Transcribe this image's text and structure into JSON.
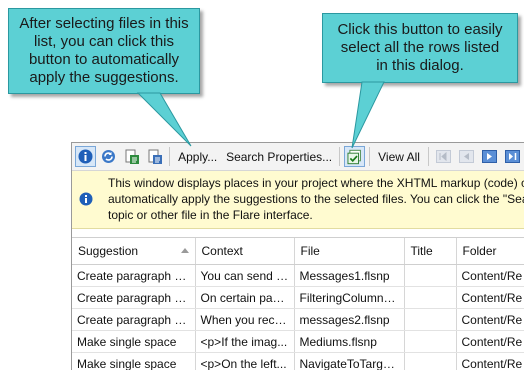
{
  "callouts": {
    "left": [
      "After selecting files in this",
      "list, you can click this",
      "button to automatically",
      "apply the suggestions."
    ],
    "right": [
      "Click this button to easily",
      "select all the rows listed",
      "in this dialog."
    ],
    "fill_color": "#5cd0d4"
  },
  "toolbar": {
    "apply_label": "Apply...",
    "search_properties_label": "Search Properties...",
    "view_all_label": "View All",
    "icons": [
      "info-icon",
      "refresh-icon",
      "open-file-icon",
      "open-file-alt-icon",
      "select-all-icon",
      "first-page-icon",
      "previous-page-icon",
      "next-page-icon",
      "last-page-icon"
    ]
  },
  "info_bar": {
    "lines": [
      "This window displays places in your project where the XHTML markup (code) c",
      "automatically apply the suggestions to the selected files. You can click the \"Sea",
      "topic or other file in the Flare interface."
    ],
    "background": "#fffbd0"
  },
  "table": {
    "columns": [
      "Suggestion",
      "Context",
      "File",
      "Title",
      "Folder"
    ],
    "rows": [
      [
        "Create paragraph tag",
        "You can send n...",
        "Messages1.flsnp",
        "",
        "Content/Re"
      ],
      [
        "Create paragraph tag",
        "On certain pag...",
        "FilteringColumns...",
        "",
        "Content/Re"
      ],
      [
        "Create paragraph tag",
        "When you rece...",
        "messages2.flsnp",
        "",
        "Content/Re"
      ],
      [
        "Make single space",
        "<p>If the imag...",
        "Mediums.flsnp",
        "",
        "Content/Re"
      ],
      [
        "Make single space",
        "<p>On the left...",
        "NavigateToTarge...",
        "",
        "Content/Re"
      ]
    ]
  }
}
